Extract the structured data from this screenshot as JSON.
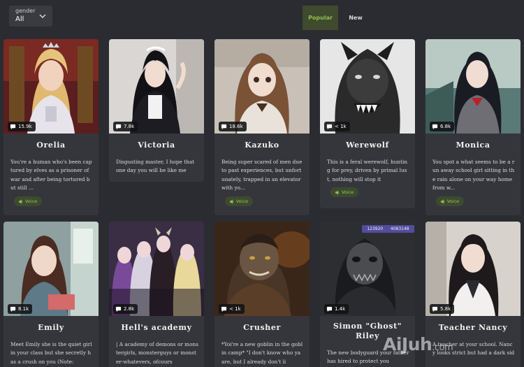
{
  "filter": {
    "label": "gender",
    "value": "All",
    "chevron_icon": "chevron-down-icon"
  },
  "tabs": [
    {
      "label": "Popular",
      "active": true
    },
    {
      "label": "New",
      "active": false
    }
  ],
  "voice_label": "Voice",
  "cards": [
    {
      "name": "Orelia",
      "count": "15.9k",
      "description": "You're a human who's been captured by elves as a prisoner of war and after being tortured but still ...",
      "voice": true
    },
    {
      "name": "Victoria",
      "count": "7.8k",
      "description": "Disgusting master, I hope that one day you will be like me",
      "voice": false
    },
    {
      "name": "Kazuko",
      "count": "18.6k",
      "description": "Being super scared of men due to past experiences, but unfortunately, trapped in an elevator with yo...",
      "voice": true
    },
    {
      "name": "Werewolf",
      "count": "< 1k",
      "description": "This is a feral werewolf, hunting for prey, driven by primal lust, nothing will stop it",
      "voice": true
    },
    {
      "name": "Monica",
      "count": "6.8k",
      "description": "You spot a what seems to be a run away school girl sitting in the rain alone on your way home from w...",
      "voice": true
    },
    {
      "name": "Emily",
      "count": "8.1k",
      "description": "Meet Emily she is the quiet girl in your class but she secretly has a crush on you (Note:",
      "voice": false
    },
    {
      "name": "Hell's academy",
      "count": "2.8k",
      "description": "| A academy of demons or monstergirls, monsterguys or monster-whatevers, ofcours",
      "voice": false
    },
    {
      "name": "Crusher",
      "count": "< 1k",
      "description": "*Yoi're a new goblin in the goblin camp* \"I don't know who ya are, but I already don't li",
      "voice": false
    },
    {
      "name": "Simon \"Ghost\" Riley",
      "count": "1.4k",
      "description": "The new bodyguard your father has hired to protect you",
      "voice": false
    },
    {
      "name": "Teacher Nancy",
      "count": "5.8k",
      "description": "A teacher at your school. Nancy looks strict but had a dark sid",
      "voice": false
    }
  ],
  "stats_badge": {
    "views": "123920",
    "chats": "4083148"
  },
  "watermark": {
    "brand": "AiJuh",
    "suffix": ".com"
  },
  "colors": {
    "accent_green": "#8dc04e",
    "card_bg": "#35363b",
    "page_bg": "#2b2c31"
  }
}
